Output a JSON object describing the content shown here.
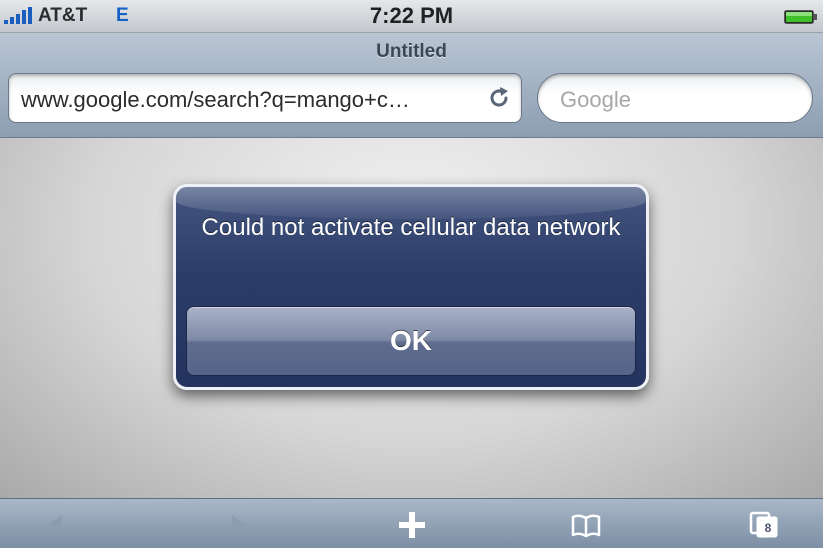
{
  "status_bar": {
    "carrier": "AT&T",
    "network_type": "E",
    "time": "7:22 PM"
  },
  "browser": {
    "page_title": "Untitled",
    "url": "www.google.com/search?q=mango+c…",
    "search_placeholder": "Google"
  },
  "alert": {
    "message": "Could not activate cellular data network",
    "ok_label": "OK"
  },
  "toolbar": {
    "pages_count": "8"
  },
  "colors": {
    "alert_background": "#2c3c69",
    "network_type": "#1560c4",
    "battery": "#3fbf2a"
  },
  "icons": [
    "signal-strength-icon",
    "battery-icon",
    "reload-icon",
    "back-arrow-icon",
    "forward-arrow-icon",
    "plus-icon",
    "bookmarks-book-icon",
    "pages-icon"
  ]
}
